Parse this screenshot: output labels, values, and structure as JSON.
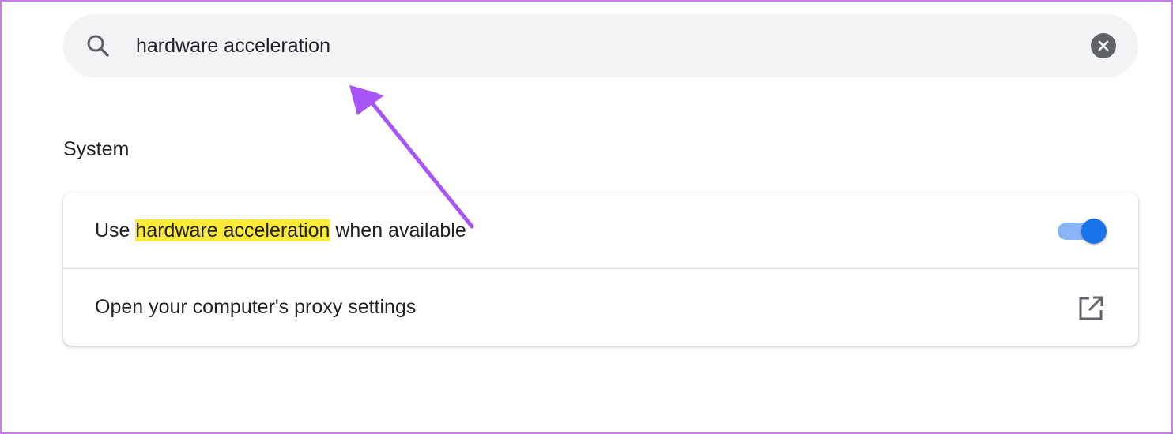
{
  "search": {
    "value": "hardware acceleration",
    "icon": "search-icon",
    "clear_icon": "close-circle-icon"
  },
  "section": {
    "title": "System"
  },
  "settings": [
    {
      "label_before": "Use ",
      "label_highlight": "hardware acceleration",
      "label_after": " when available",
      "control": "toggle",
      "toggle_on": true
    },
    {
      "label": "Open your computer's proxy settings",
      "control": "external-link-icon"
    }
  ],
  "colors": {
    "frame_border": "#c77ee6",
    "search_bg": "#f1f3f4",
    "highlight": "#fbea39",
    "toggle_track": "#8ab4f8",
    "toggle_knob": "#1a73e8",
    "annotation_arrow": "#a855f7"
  }
}
